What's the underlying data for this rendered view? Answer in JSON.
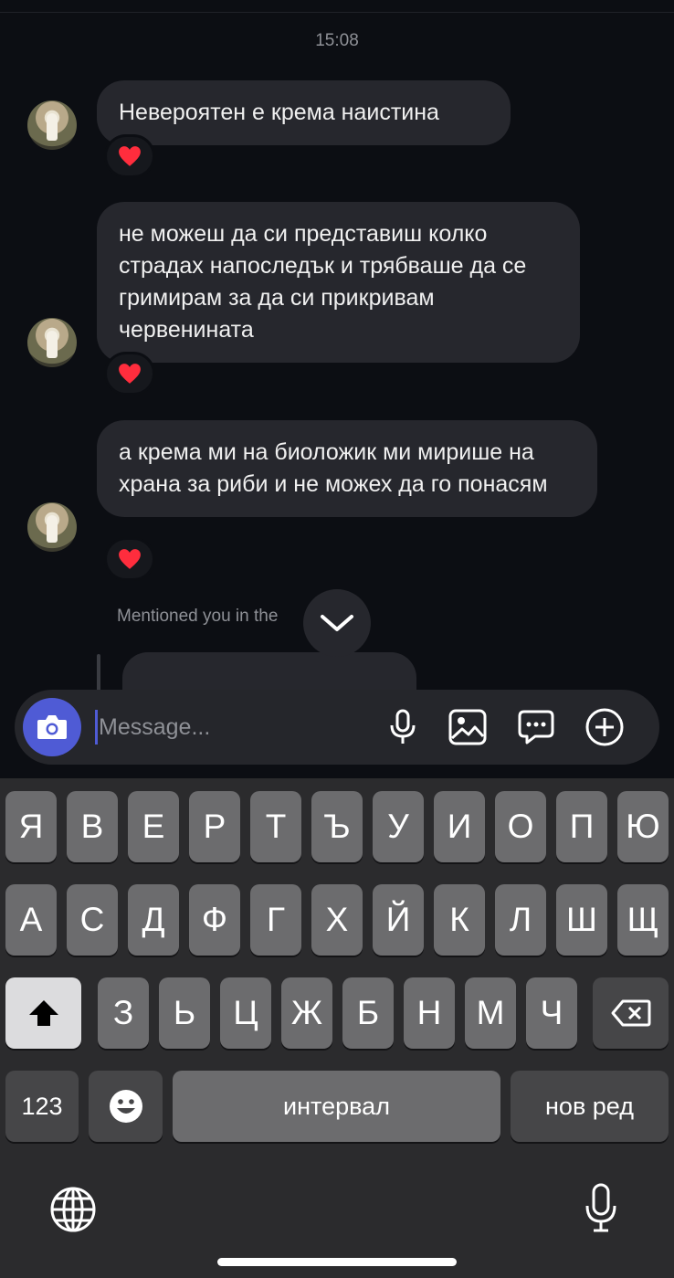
{
  "chat": {
    "timestamp": "15:08",
    "messages": [
      {
        "text": "Невероятен е крема наистина",
        "reaction": "heart"
      },
      {
        "text": "не можеш да си представиш колко страдах напоследък и трябваше да се гримирам за да си прикривам червенината",
        "reaction": "heart"
      },
      {
        "text": "а крема ми на биоложик ми мирише на храна за риби и не можех да го понасям",
        "reaction": "heart"
      }
    ],
    "mention_text": "Mentioned you in the"
  },
  "composer": {
    "placeholder": "Message...",
    "icons": [
      "camera-icon",
      "microphone-icon",
      "gallery-icon",
      "sticker-icon",
      "add-icon"
    ],
    "accent": "#4f5bd5"
  },
  "keyboard": {
    "row1": [
      "Я",
      "В",
      "Е",
      "Р",
      "Т",
      "Ъ",
      "У",
      "И",
      "О",
      "П",
      "Ю"
    ],
    "row2": [
      "А",
      "С",
      "Д",
      "Ф",
      "Г",
      "Х",
      "Й",
      "К",
      "Л",
      "Ш",
      "Щ"
    ],
    "row3": [
      "З",
      "Ь",
      "Ц",
      "Ж",
      "Б",
      "Н",
      "М",
      "Ч"
    ],
    "numbers_label": "123",
    "space_label": "интервал",
    "return_label": "нов ред"
  }
}
